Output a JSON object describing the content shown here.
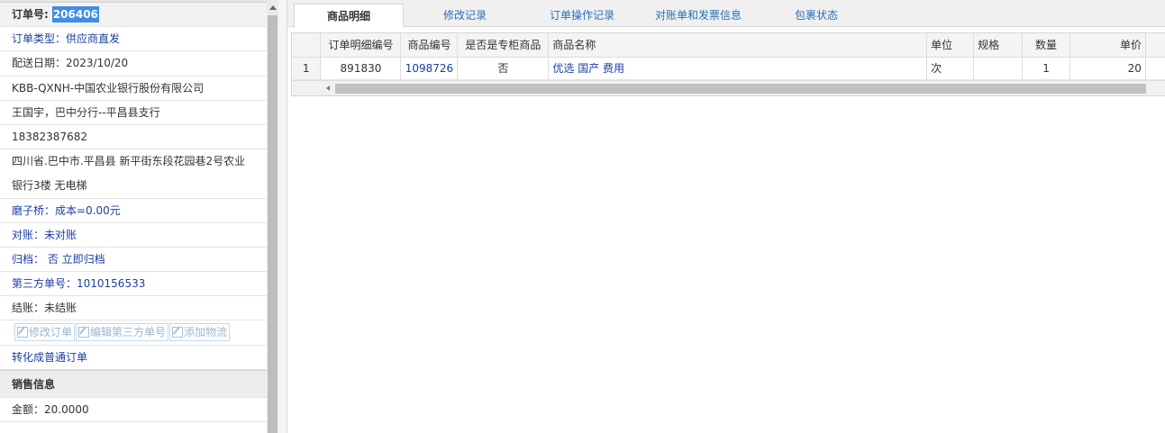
{
  "order": {
    "label": "订单号:",
    "number": "206406",
    "type": "订单类型：供应商直发",
    "delivery_date": "配送日期：2023/10/20",
    "company": "KBB-QXNH-中国农业银行股份有限公司",
    "contact": "王国宇，巴中分行--平昌县支行",
    "phone": "18382387682",
    "address_line1": "四川省.巴中市.平昌县 新平街东段花园巷2号农业",
    "address_line2": "银行3楼 无电梯",
    "cost": "磨子桥：成本=0.00元",
    "reconcile": "对账：未对账",
    "archive": "归档： 否 立即归档",
    "third_party": "第三方单号：1010156533",
    "settlement": "结账：未结账"
  },
  "actions": {
    "edit_order": "修改订单",
    "edit_third_party": "编辑第三方单号",
    "add_logistics": "添加物流",
    "convert": "转化成普通订单"
  },
  "sales": {
    "section_title": "销售信息",
    "amount": "金额：20.0000"
  },
  "tabs": [
    {
      "label": "商品明细",
      "active": true
    },
    {
      "label": "修改记录",
      "active": false
    },
    {
      "label": "订单操作记录",
      "active": false
    },
    {
      "label": "对账单和发票信息",
      "active": false
    },
    {
      "label": "包裹状态",
      "active": false
    }
  ],
  "grid": {
    "columns": [
      "订单明细编号",
      "商品编号",
      "是否是专柜商品",
      "商品名称",
      "单位",
      "规格",
      "数量",
      "单价"
    ],
    "rows": [
      {
        "index": "1",
        "detail_id": "891830",
        "product_id": "1098726",
        "is_counter": "否",
        "name": "优选 国产 费用",
        "unit": "次",
        "spec": "",
        "qty": "1",
        "price": "20"
      }
    ]
  },
  "colors": {
    "accent_blue": "#1a3fa3",
    "highlight": "#3d8ee6",
    "tab_link": "#2a6fb8"
  }
}
